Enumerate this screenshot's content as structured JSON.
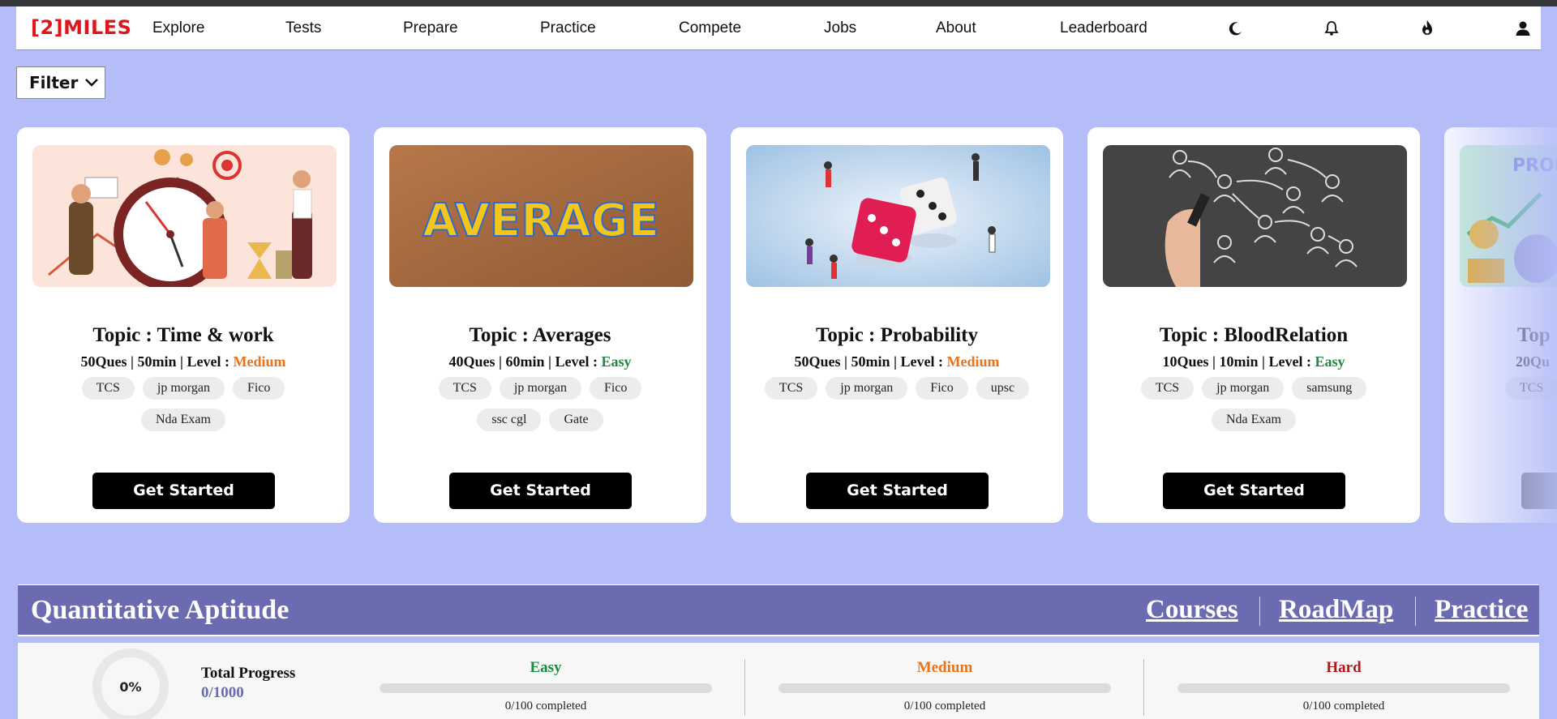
{
  "nav": {
    "logo": "[2]MILES",
    "items": [
      "Explore",
      "Tests",
      "Prepare",
      "Practice",
      "Compete",
      "Jobs",
      "About",
      "Leaderboard"
    ],
    "icons": [
      "moon-icon",
      "bell-icon",
      "fire-icon",
      "user-icon"
    ]
  },
  "filter": {
    "label": "Filter"
  },
  "cards": [
    {
      "topic": "Topic : Time & work",
      "ques": "50Ques",
      "time": "50min",
      "level_label": "Level :",
      "level": "Medium",
      "tags": [
        "TCS",
        "jp morgan",
        "Fico",
        "Nda Exam"
      ],
      "button": "Get Started"
    },
    {
      "topic": "Topic : Averages",
      "ques": "40Ques",
      "time": "60min",
      "level_label": "Level :",
      "level": "Easy",
      "tags": [
        "TCS",
        "jp morgan",
        "Fico",
        "ssc cgl",
        "Gate"
      ],
      "button": "Get Started",
      "image_text": "AVERAGE"
    },
    {
      "topic": "Topic : Probability",
      "ques": "50Ques",
      "time": "50min",
      "level_label": "Level :",
      "level": "Medium",
      "tags": [
        "TCS",
        "jp morgan",
        "Fico",
        "upsc"
      ],
      "button": "Get Started"
    },
    {
      "topic": "Topic : BloodRelation",
      "ques": "10Ques",
      "time": "10min",
      "level_label": "Level :",
      "level": "Easy",
      "tags": [
        "TCS",
        "jp morgan",
        "samsung",
        "Nda Exam"
      ],
      "button": "Get Started"
    },
    {
      "topic": "Top",
      "ques": "20Qu",
      "tags": [
        "TCS"
      ],
      "image_text": "PROF"
    }
  ],
  "section": {
    "title": "Quantitative Aptitude",
    "links": [
      "Courses",
      "RoadMap",
      "Practice"
    ]
  },
  "progress": {
    "percent_text": "0%",
    "total_label": "Total Progress",
    "total_value": "0/1000",
    "levels": [
      {
        "name": "Easy",
        "completed": "0/100 completed",
        "fraction": 0,
        "color": "#1e8a3f"
      },
      {
        "name": "Medium",
        "completed": "0/100 completed",
        "fraction": 0,
        "color": "#e8731b"
      },
      {
        "name": "Hard",
        "completed": "0/100 completed",
        "fraction": 0,
        "color": "#b01818"
      }
    ]
  },
  "colors": {
    "brand_red": "#e0151b",
    "page_bg": "#b4bdf8",
    "section_bar": "#6a6bb0",
    "medium": "#e8731b",
    "easy": "#1e8a3f"
  }
}
